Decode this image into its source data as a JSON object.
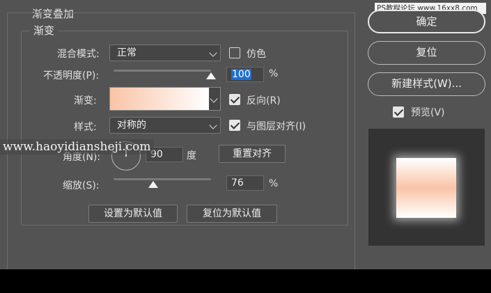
{
  "section_title": "渐变叠加",
  "group_title": "渐变",
  "watermark_top": "PS教程论坛 www.16xx8.com",
  "watermark_mid": "www.haoyidiansheji.com",
  "blend": {
    "label": "混合模式:",
    "value": "正常",
    "dither_label": "仿色",
    "dither_checked": false
  },
  "opacity": {
    "label": "不透明度(P):",
    "value": "100",
    "unit": "%",
    "level": 1.0
  },
  "gradient": {
    "label": "渐变:",
    "reverse_label": "反向(R)",
    "reverse_checked": true,
    "stop_start": "#f9c4a6",
    "stop_end": "#ffffff"
  },
  "style": {
    "label": "样式:",
    "value": "对称的",
    "align_label": "与图层对齐(I)",
    "align_checked": true
  },
  "angle": {
    "label": "角度(N):",
    "value": "90",
    "unit": "度",
    "reset_label": "重置对齐"
  },
  "scale": {
    "label": "缩放(S):",
    "value": "76",
    "unit": "%",
    "level": 0.41
  },
  "defaults": {
    "set_label": "设置为默认值",
    "reset_label": "复位为默认值"
  },
  "side": {
    "ok": "确定",
    "reset": "复位",
    "new_style": "新建样式(W)...",
    "preview_label": "预览(V)",
    "preview_checked": true
  },
  "colors": {
    "panel_bg": "#535353",
    "preview_bg": "#333333",
    "accent": "#1f6fd1"
  }
}
